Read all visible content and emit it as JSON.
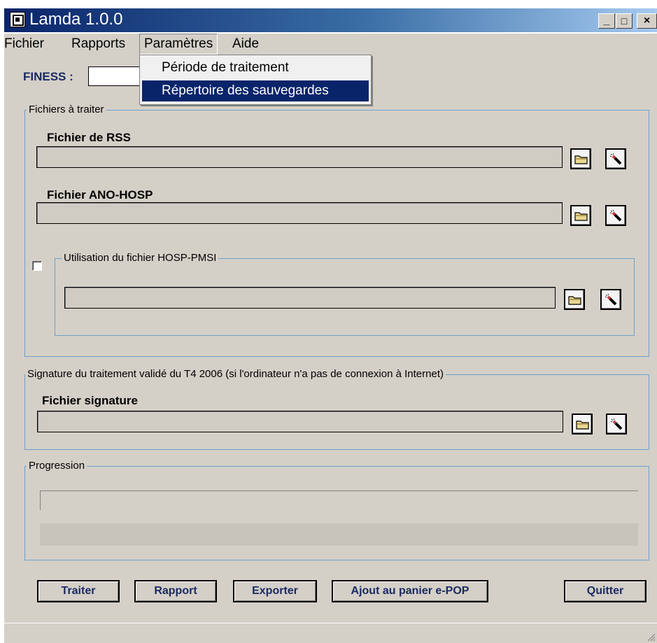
{
  "window": {
    "title": "Lamda 1.0.0",
    "minimize_label": "_",
    "maximize_label": "□",
    "close_label": "×"
  },
  "menubar": {
    "items": [
      "Fichier",
      "Rapports",
      "Paramètres",
      "Aide"
    ]
  },
  "dropdown": {
    "items": [
      "Période de traitement",
      "Répertoire des sauvegardes"
    ],
    "highlighted_index": 1
  },
  "finess": {
    "label": "FINESS :",
    "value": ""
  },
  "group_fichiers": {
    "title": "Fichiers à traiter",
    "rss_label": "Fichier de RSS",
    "ano_label": "Fichier ANO-HOSP",
    "hosp_title": "Utilisation du fichier HOSP-PMSI",
    "hosp_checked": false
  },
  "group_signature": {
    "title": "Signature du traitement validé du T4 2006 (si l'ordinateur n'a pas de connexion à Internet)",
    "file_label": "Fichier signature"
  },
  "group_progression": {
    "title": "Progression"
  },
  "buttons": {
    "traiter": "Traiter",
    "rapport": "Rapport",
    "exporter": "Exporter",
    "panier": "Ajout au panier e-POP",
    "quitter": "Quitter"
  },
  "icons": {
    "folder": "folder-icon",
    "clear": "eraser-icon"
  },
  "colors": {
    "titlebar_start": "#0a246a",
    "titlebar_end": "#a6caf0",
    "group_border": "#6ea0c8",
    "button_text": "#1a2a60",
    "highlight": "#0a246a"
  }
}
